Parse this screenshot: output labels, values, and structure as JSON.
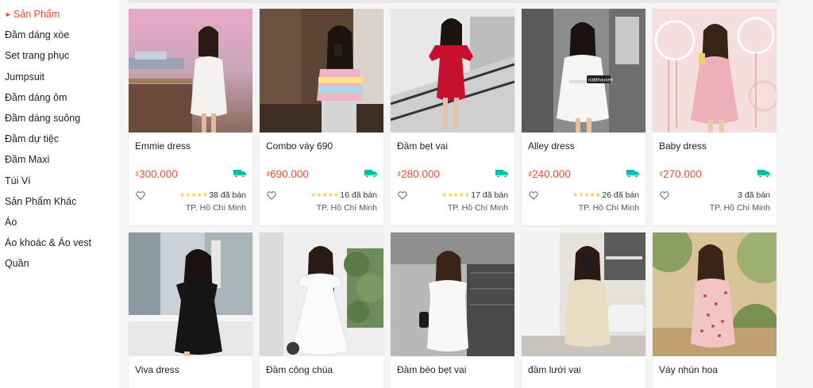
{
  "sidebar": {
    "items": [
      {
        "label": "Sản Phẩm",
        "active": true
      },
      {
        "label": "Đầm dáng xòe"
      },
      {
        "label": "Set trang phục"
      },
      {
        "label": "Jumpsuit"
      },
      {
        "label": "Đầm dáng ôm"
      },
      {
        "label": "Đầm dáng suông"
      },
      {
        "label": "Đầm dự tiệc"
      },
      {
        "label": "Đầm Maxi"
      },
      {
        "label": "Túi Ví"
      },
      {
        "label": "Sản Phẩm Khác"
      },
      {
        "label": "Áo"
      },
      {
        "label": "Áo khoác & Áo vest"
      },
      {
        "label": "Quần"
      }
    ]
  },
  "colors": {
    "accent": "#ee4d2d",
    "star": "#ffce3d",
    "free_ship": "#00bfa5"
  },
  "products": [
    {
      "name": "Emmie dress",
      "currency": "₫",
      "price": "300.000",
      "rating": 5,
      "sold": "38 đã bán",
      "location": "TP. Hồ Chí Minh",
      "image": "woman-white-dress-sunset-pier",
      "ship_badge": "free-shipping-icon"
    },
    {
      "name": "Combo váy 690",
      "currency": "₫",
      "price": "690.000",
      "rating": 5,
      "sold": "16 đã bán",
      "location": "TP. Hồ Chí Minh",
      "image": "woman-pastel-stripe-top-mirror",
      "ship_badge": "free-shipping-icon"
    },
    {
      "name": "Đầm bẹt vai",
      "currency": "₫",
      "price": "280.000",
      "rating": 5,
      "sold": "17 đã bán",
      "location": "TP. Hồ Chí Minh",
      "image": "woman-red-offshoulder-dress-stairs",
      "ship_badge": "free-shipping-icon"
    },
    {
      "name": "Alley dress",
      "currency": "₫",
      "price": "240.000",
      "rating": 5,
      "sold": "26 đã bán",
      "location": "TP. Hồ Chí Minh",
      "image": "woman-white-dress-window",
      "ship_badge": "free-shipping-icon",
      "watermark": "nabihousee"
    },
    {
      "name": "Baby dress",
      "currency": "₫",
      "price": "270.000",
      "rating": 0,
      "sold": "3 đã bán",
      "location": "TP. Hồ Chí Minh",
      "image": "woman-pink-dress-dreamcatchers",
      "ship_badge": "free-shipping-icon"
    },
    {
      "name": "Viva dress",
      "image": "woman-black-dress-balcony"
    },
    {
      "name": "Đầm công chúa",
      "image": "woman-white-lace-dress-plants"
    },
    {
      "name": "Đầm bèo bẹt vai",
      "image": "woman-white-ruffle-dress-wall"
    },
    {
      "name": "đầm lưới vai",
      "image": "woman-beige-dress-mirror"
    },
    {
      "name": "Váy nhún hoa",
      "image": "woman-floral-dress-garden"
    }
  ]
}
